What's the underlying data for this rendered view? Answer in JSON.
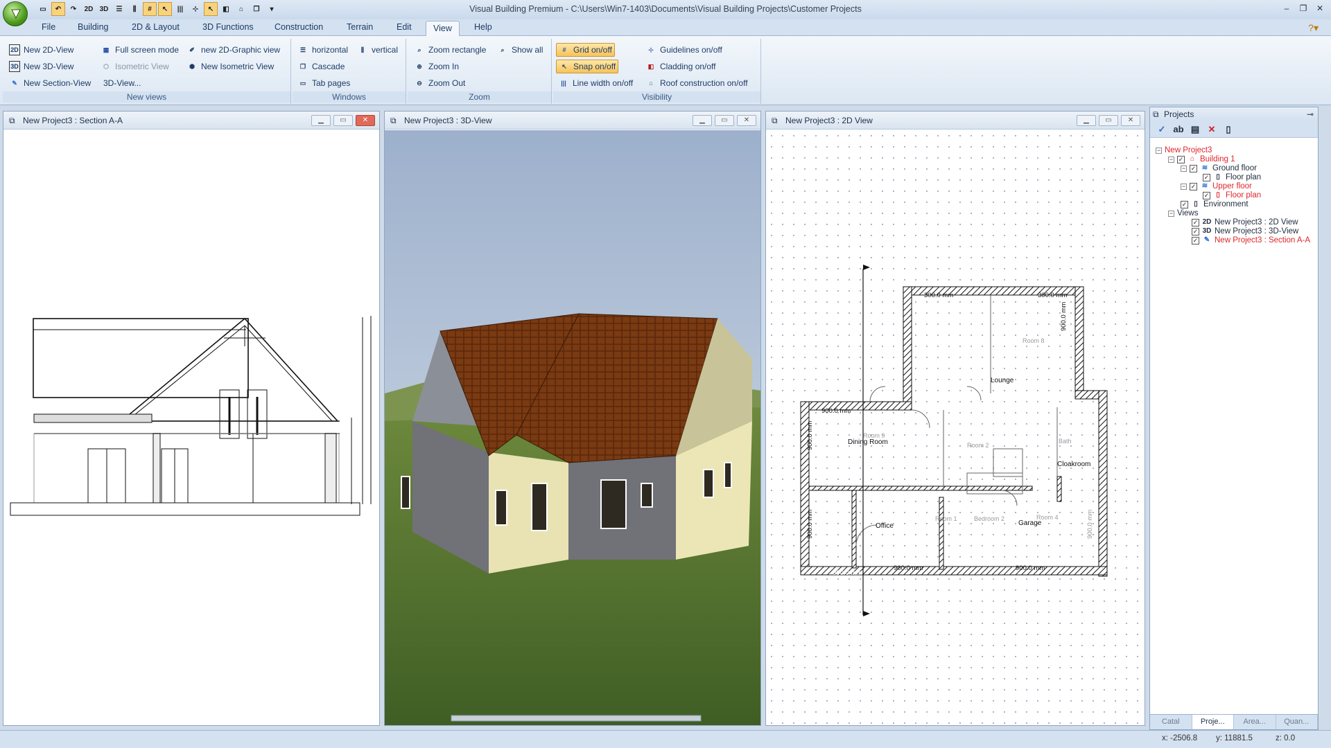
{
  "window": {
    "title": "Visual Building Premium - C:\\Users\\Win7-1403\\Documents\\Visual Building Projects\\Customer Projects"
  },
  "menu": {
    "tabs": [
      "File",
      "Building",
      "2D & Layout",
      "3D Functions",
      "Construction",
      "Terrain",
      "Edit",
      "View",
      "Help"
    ],
    "active": "View"
  },
  "ribbon": {
    "new_views": {
      "label": "New views",
      "new_2d_view": "New 2D-View",
      "new_3d_view": "New 3D-View",
      "new_section_view": "New Section-View",
      "full_screen_mode": "Full screen mode",
      "isometric_view": "Isometric View",
      "three_d_view_menu": "3D-View...",
      "new_2d_graphic_view": "new 2D-Graphic view",
      "new_isometric_view": "New Isometric View"
    },
    "windows": {
      "label": "Windows",
      "horizontal": "horizontal",
      "vertical": "vertical",
      "cascade": "Cascade",
      "tab_pages": "Tab pages"
    },
    "zoom": {
      "label": "Zoom",
      "zoom_rectangle": "Zoom rectangle",
      "show_all": "Show all",
      "zoom_in": "Zoom In",
      "zoom_out": "Zoom Out"
    },
    "visibility": {
      "label": "Visibility",
      "grid": "Grid on/off",
      "snap": "Snap on/off",
      "line_width": "Line width on/off",
      "guidelines": "Guidelines on/off",
      "cladding": "Cladding on/off",
      "roof_construction": "Roof construction on/off"
    }
  },
  "panels": {
    "section": {
      "title": "New Project3 : Section A-A"
    },
    "view3d": {
      "title": "New Project3 : 3D-View"
    },
    "view2d": {
      "title": "New Project3 : 2D View"
    }
  },
  "floorplan": {
    "rooms": [
      "Lounge",
      "Dining Room",
      "Office",
      "Garage",
      "Cloakroom"
    ],
    "room_placeholders": [
      "Room 8",
      "Room 9",
      "Room 2",
      "Room 1",
      "Bedroom 2",
      "Room 4",
      "Bath"
    ],
    "dims": [
      "300.0 mm",
      "300.0 mm",
      "900.0 mm",
      "900.0 mm",
      "900.0 mm",
      "900.0 mm",
      "900.0 mm",
      "900.0 mm",
      "900.0 mm",
      "900.0 mm"
    ]
  },
  "projects": {
    "title": "Projects",
    "tree": {
      "project": "New Project3",
      "building": "Building 1",
      "ground_floor": "Ground floor",
      "ground_floor_plan": "Floor plan",
      "upper_floor": "Upper floor",
      "upper_floor_plan": "Floor plan",
      "environment": "Environment",
      "views": "Views",
      "view_2d": "New Project3 : 2D View",
      "view_3d": "New Project3 : 3D-View",
      "view_section": "New Project3 : Section A-A"
    },
    "tabs": [
      "Catal",
      "Proje...",
      "Area...",
      "Quan..."
    ]
  },
  "status": {
    "x": "x: -2506.8",
    "y": "y: 11881.5",
    "z": "z: 0.0"
  }
}
